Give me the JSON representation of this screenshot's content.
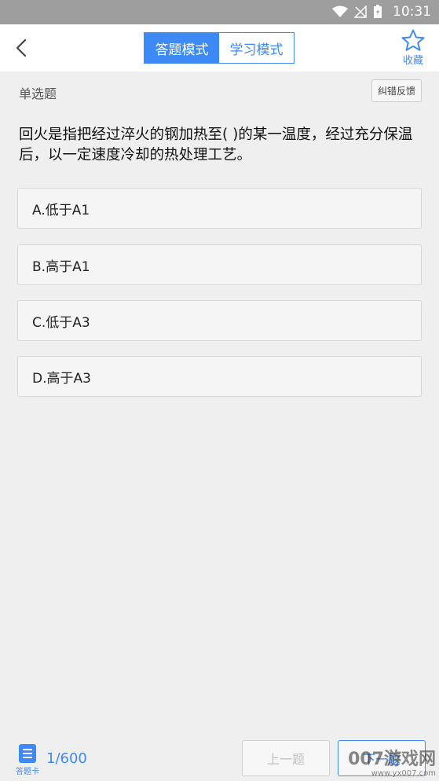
{
  "status_bar": {
    "time": "10:31"
  },
  "header": {
    "tabs": [
      {
        "label": "答题模式",
        "active": true
      },
      {
        "label": "学习模式",
        "active": false
      }
    ],
    "favorite_label": "收藏"
  },
  "question": {
    "type_label": "单选题",
    "report_label": "纠错反馈",
    "text": "回火是指把经过淬火的钢加热至( )的某一温度，经过充分保温后，以一定速度冷却的热处理工艺。",
    "options": [
      {
        "label": "A.低于A1"
      },
      {
        "label": "B.高于A1"
      },
      {
        "label": "C.低于A3"
      },
      {
        "label": "D.高于A3"
      }
    ]
  },
  "footer": {
    "card_label": "答题卡",
    "progress": "1/600",
    "prev_label": "上一题",
    "next_label": "下一题"
  },
  "watermark": {
    "main": "007游戏网",
    "url": "www.yx007.com"
  },
  "colors": {
    "accent": "#3d8af7",
    "status_bar": "#9e9e9e",
    "background": "#efefef"
  }
}
